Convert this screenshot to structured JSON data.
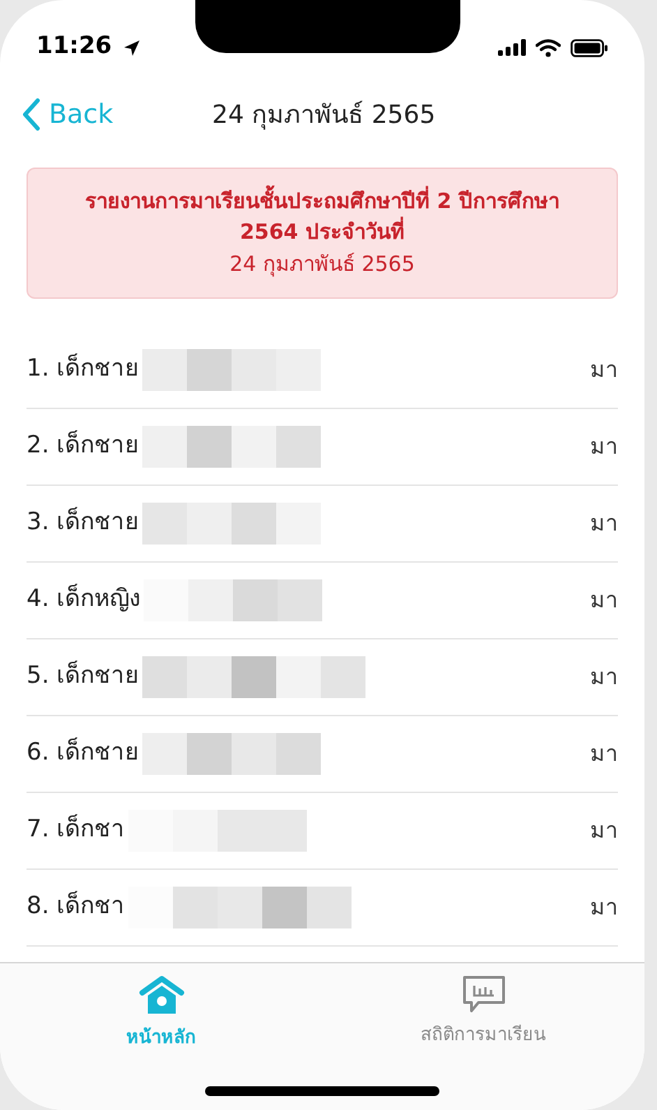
{
  "status_bar": {
    "time": "11:26"
  },
  "nav": {
    "back": "Back",
    "title": "24 กุมภาพันธ์ 2565"
  },
  "banner": {
    "heading": "รายงานการมาเรียนชั้นประถมศึกษาปีที่ 2 ปีการศึกษา 2564 ประจำวันที่",
    "date": "24 กุมภาพันธ์ 2565"
  },
  "students": [
    {
      "label": "1. เด็กชาย",
      "status": "มา"
    },
    {
      "label": "2. เด็กชาย",
      "status": "มา"
    },
    {
      "label": "3. เด็กชาย",
      "status": "มา"
    },
    {
      "label": "4. เด็กหญิง",
      "status": "มา"
    },
    {
      "label": "5. เด็กชาย",
      "status": "มา"
    },
    {
      "label": "6. เด็กชาย",
      "status": "มา"
    },
    {
      "label": "7. เด็กชา",
      "status": "มา"
    },
    {
      "label": "8. เด็กชา",
      "status": "มา"
    }
  ],
  "tab_bar": [
    {
      "kind": "home",
      "label": "หน้าหลัก",
      "selected": true
    },
    {
      "kind": "stats",
      "label": "สถิติการมาเรียน",
      "selected": false
    }
  ]
}
